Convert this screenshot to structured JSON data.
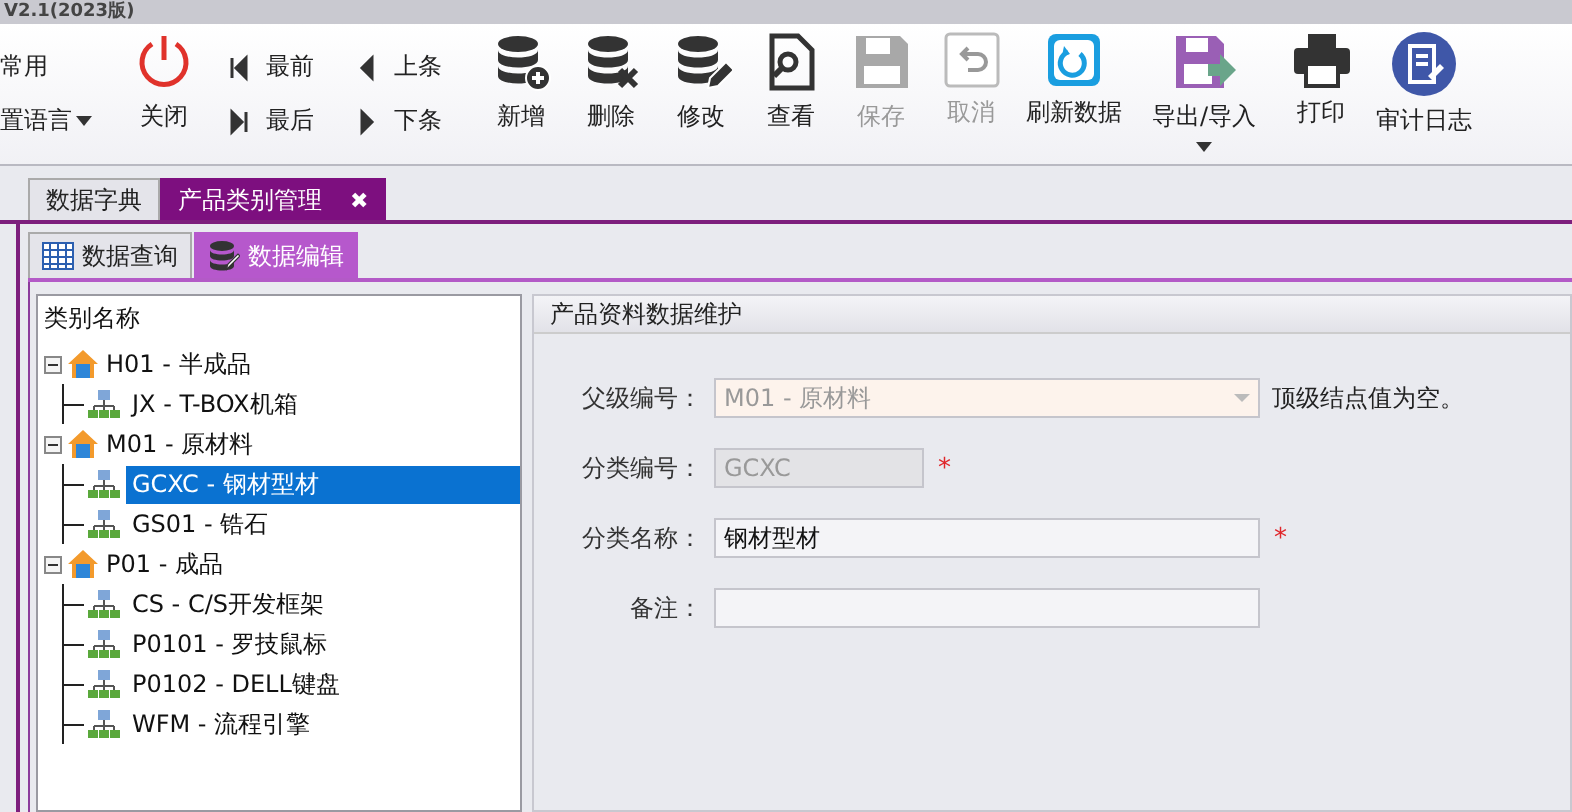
{
  "window": {
    "title": "V2.1(2023版)"
  },
  "toolbar": {
    "left_items": [
      {
        "label": "常用",
        "kind": "plain"
      },
      {
        "label": "置语言",
        "kind": "dropdown"
      }
    ],
    "close": {
      "label": "关闭"
    },
    "nav": [
      {
        "label": "最前",
        "kind": "first"
      },
      {
        "label": "最后",
        "kind": "last"
      },
      {
        "label": "上条",
        "kind": "prev"
      },
      {
        "label": "下条",
        "kind": "next"
      }
    ],
    "buttons": [
      {
        "label": "新增",
        "kind": "add",
        "disabled": false
      },
      {
        "label": "删除",
        "kind": "delete",
        "disabled": false
      },
      {
        "label": "修改",
        "kind": "edit",
        "disabled": false
      },
      {
        "label": "查看",
        "kind": "view",
        "disabled": false
      },
      {
        "label": "保存",
        "kind": "save",
        "disabled": true
      },
      {
        "label": "取消",
        "kind": "undo",
        "disabled": true
      },
      {
        "label": "刷新数据",
        "kind": "refresh",
        "disabled": false
      },
      {
        "label": "导出/导入",
        "kind": "export",
        "disabled": false,
        "menu_caret": true
      },
      {
        "label": "打印",
        "kind": "print",
        "disabled": false
      },
      {
        "label": "审计日志",
        "kind": "audit",
        "disabled": false
      }
    ]
  },
  "doc_tabs": [
    {
      "label": "数据字典",
      "selected": false
    },
    {
      "label": "产品类别管理",
      "selected": true,
      "close_glyph": "✖"
    }
  ],
  "sub_tabs": [
    {
      "label": "数据查询",
      "kind": "grid",
      "selected": false
    },
    {
      "label": "数据编辑",
      "kind": "edit",
      "selected": true
    }
  ],
  "tree": {
    "header": "类别名称",
    "items": [
      {
        "label": "H01 - 半成品",
        "kind": "group",
        "expanded": true,
        "selected": false,
        "children": [
          {
            "label": "JX - T-BOX机箱",
            "kind": "leaf",
            "selected": false
          }
        ]
      },
      {
        "label": "M01 - 原材料",
        "kind": "group",
        "expanded": true,
        "selected": false,
        "children": [
          {
            "label": "GCXC - 钢材型材",
            "kind": "leaf",
            "selected": true
          },
          {
            "label": "GS01 - 锆石",
            "kind": "leaf",
            "selected": false
          }
        ]
      },
      {
        "label": "P01 - 成品",
        "kind": "group",
        "expanded": true,
        "selected": false,
        "children": [
          {
            "label": "CS - C/S开发框架",
            "kind": "leaf",
            "selected": false
          },
          {
            "label": "P0101 - 罗技鼠标",
            "kind": "leaf",
            "selected": false
          },
          {
            "label": "P0102 - DELL键盘",
            "kind": "leaf",
            "selected": false
          },
          {
            "label": "WFM - 流程引擎",
            "kind": "leaf",
            "selected": false
          }
        ]
      }
    ]
  },
  "form": {
    "title": "产品资料数据维护",
    "fields": [
      {
        "label": "父级编号：",
        "kind": "select",
        "value": "M01 - 原材料",
        "disabled": true,
        "note": "顶级结点值为空。"
      },
      {
        "label": "分类编号：",
        "kind": "short_text",
        "value": "GCXC",
        "disabled": true,
        "required_mark": "*"
      },
      {
        "label": "分类名称：",
        "kind": "text",
        "value": "钢材型材",
        "disabled": false,
        "required_mark": "*"
      },
      {
        "label": "备注：",
        "kind": "text",
        "disabled": false
      }
    ]
  }
}
